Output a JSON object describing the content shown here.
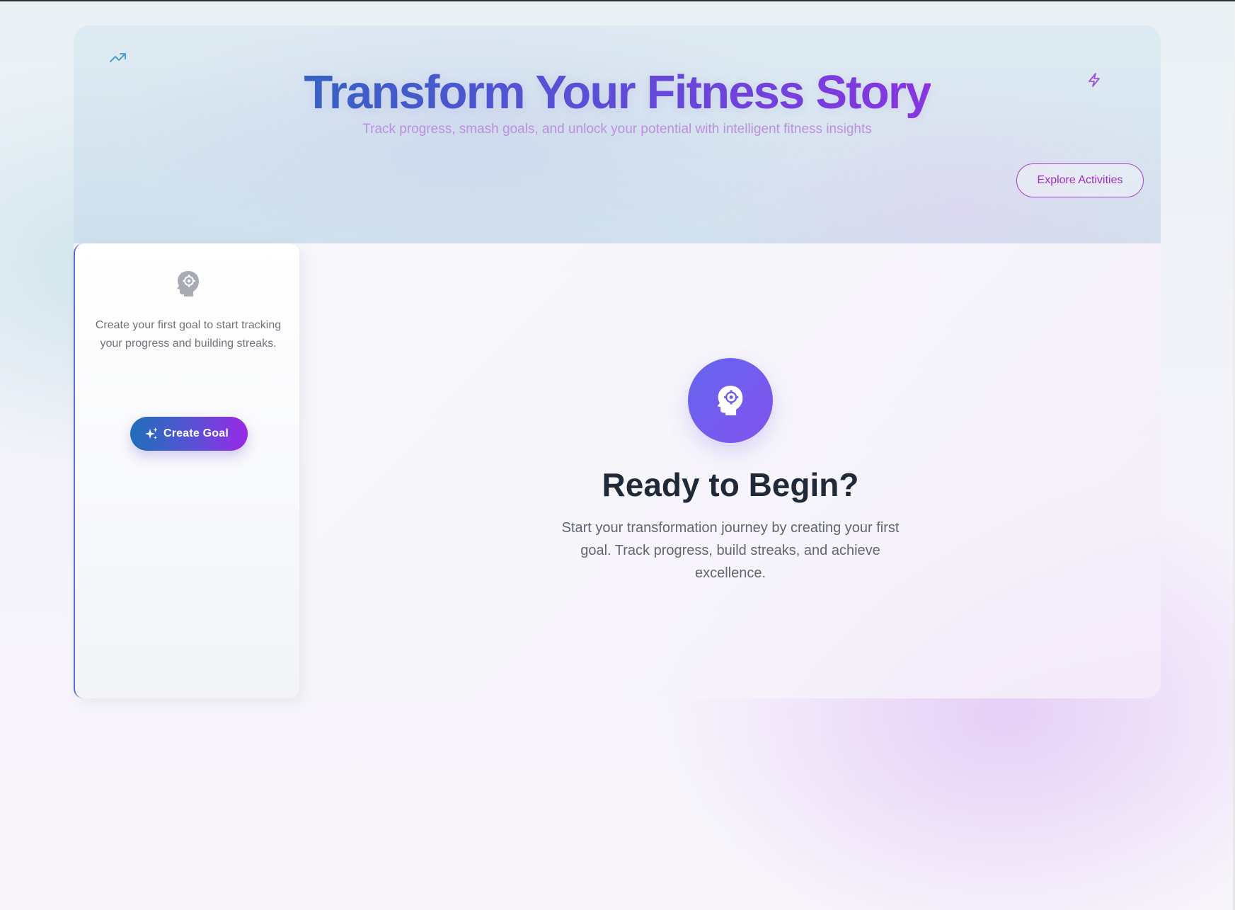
{
  "hero": {
    "title": "Transform Your Fitness Story",
    "subtitle": "Track progress, smash goals, and unlock your potential with intelligent fitness insights",
    "explore_button_label": "Explore Activities",
    "left_icon": "trending-up-icon",
    "right_icon": "lightning-bolt-icon"
  },
  "sidebar": {
    "icon": "head-gear-icon",
    "empty_text": "Create your first goal to start tracking your progress and building streaks.",
    "create_goal_label": "Create Goal",
    "create_goal_icon": "sparkles-icon"
  },
  "main": {
    "icon": "head-gear-icon",
    "title": "Ready to Begin?",
    "description": "Start your transformation journey by creating your first goal. Track progress, build streaks, and achieve excellence."
  },
  "colors": {
    "accent_blue": "#3563c3",
    "accent_purple": "#8b33e0",
    "explore_border": "#a742c9",
    "icon_circle": "#6a5ef0",
    "heading_text": "#1f2937",
    "body_text": "#5f6571"
  }
}
